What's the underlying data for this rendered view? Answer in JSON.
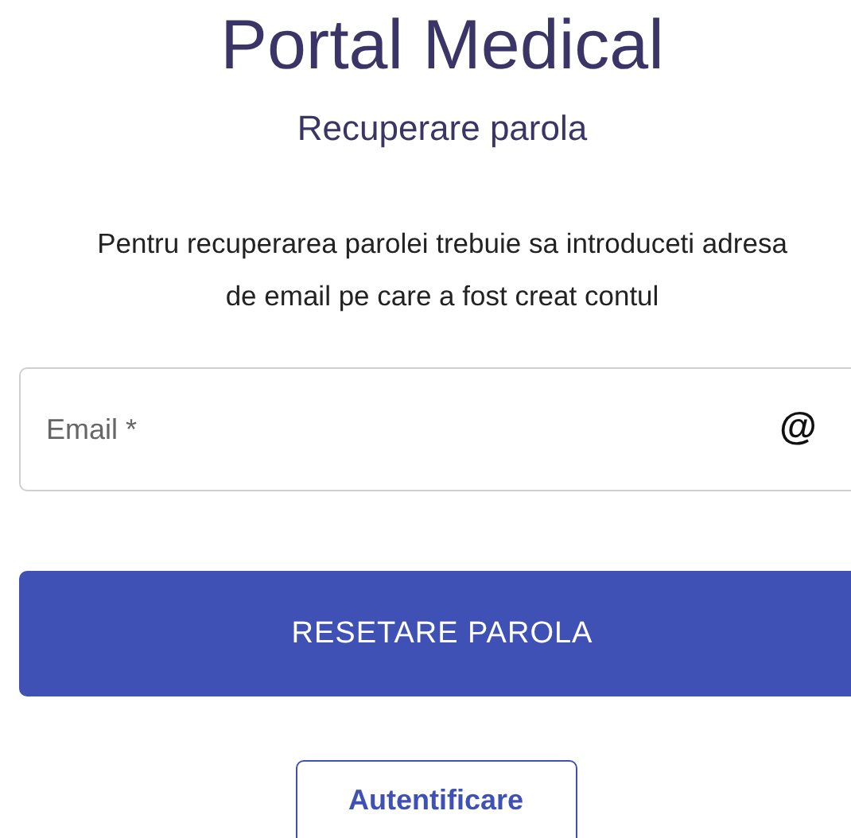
{
  "title": "Portal Medical",
  "subtitle": "Recuperare parola",
  "instructions": "Pentru recuperarea parolei trebuie sa introduceti adresa de email pe care a fost creat contul",
  "email_field": {
    "placeholder": "Email *",
    "icon": "@"
  },
  "buttons": [
    {
      "label": "RESETARE PAROLA",
      "kind": "primary"
    },
    {
      "label": "Autentificare",
      "kind": "outlined"
    }
  ]
}
